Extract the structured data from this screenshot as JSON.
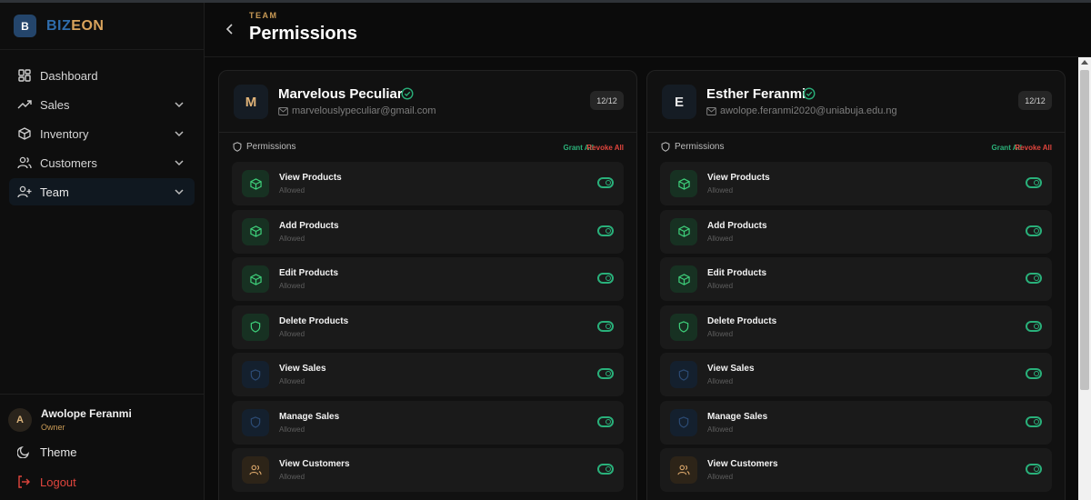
{
  "brand": {
    "mark": "B",
    "name_part1": "BIZ",
    "name_part2": "EON"
  },
  "sidebar": {
    "items": [
      {
        "label": "Dashboard",
        "icon": "dashboard-icon",
        "has_chevron": false
      },
      {
        "label": "Sales",
        "icon": "trend-icon",
        "has_chevron": true
      },
      {
        "label": "Inventory",
        "icon": "box-icon",
        "has_chevron": true
      },
      {
        "label": "Customers",
        "icon": "users-icon",
        "has_chevron": true
      },
      {
        "label": "Team",
        "icon": "user-plus-icon",
        "has_chevron": true,
        "active": true
      }
    ],
    "user": {
      "initial": "A",
      "name": "Awolope Feranmi",
      "role": "Owner"
    },
    "theme_label": "Theme",
    "logout_label": "Logout"
  },
  "header": {
    "eyebrow": "TEAM",
    "title": "Permissions"
  },
  "members": [
    {
      "initial": "M",
      "name": "Marvelous Peculiar",
      "email": "marvelouslypeculiar@gmail.com",
      "count": "12/12",
      "permissions_label": "Permissions",
      "grant_all": "Grant All",
      "revoke_all": "Revoke All",
      "permissions": [
        {
          "name": "View Products",
          "status": "Allowed",
          "icon": "box-icon",
          "tone": "green"
        },
        {
          "name": "Add Products",
          "status": "Allowed",
          "icon": "box-icon",
          "tone": "green"
        },
        {
          "name": "Edit Products",
          "status": "Allowed",
          "icon": "box-icon",
          "tone": "green"
        },
        {
          "name": "Delete Products",
          "status": "Allowed",
          "icon": "shield-icon",
          "tone": "green"
        },
        {
          "name": "View Sales",
          "status": "Allowed",
          "icon": "shield-icon",
          "tone": "blue"
        },
        {
          "name": "Manage Sales",
          "status": "Allowed",
          "icon": "shield-icon",
          "tone": "blue"
        },
        {
          "name": "View Customers",
          "status": "Allowed",
          "icon": "users-icon",
          "tone": "amber"
        }
      ]
    },
    {
      "initial": "E",
      "name": "Esther Feranmi",
      "email": "awolope.feranmi2020@uniabuja.edu.ng",
      "count": "12/12",
      "permissions_label": "Permissions",
      "grant_all": "Grant All",
      "revoke_all": "Revoke All",
      "permissions": [
        {
          "name": "View Products",
          "status": "Allowed",
          "icon": "box-icon",
          "tone": "green"
        },
        {
          "name": "Add Products",
          "status": "Allowed",
          "icon": "box-icon",
          "tone": "green"
        },
        {
          "name": "Edit Products",
          "status": "Allowed",
          "icon": "box-icon",
          "tone": "green"
        },
        {
          "name": "Delete Products",
          "status": "Allowed",
          "icon": "shield-icon",
          "tone": "green"
        },
        {
          "name": "View Sales",
          "status": "Allowed",
          "icon": "shield-icon",
          "tone": "blue"
        },
        {
          "name": "Manage Sales",
          "status": "Allowed",
          "icon": "shield-icon",
          "tone": "blue"
        },
        {
          "name": "View Customers",
          "status": "Allowed",
          "icon": "users-icon",
          "tone": "amber"
        }
      ]
    }
  ],
  "colors": {
    "accent_gold": "#c99a55",
    "toggle_on": "#29b07a",
    "danger": "#e0453d",
    "brand_blue": "#2f6dad"
  }
}
